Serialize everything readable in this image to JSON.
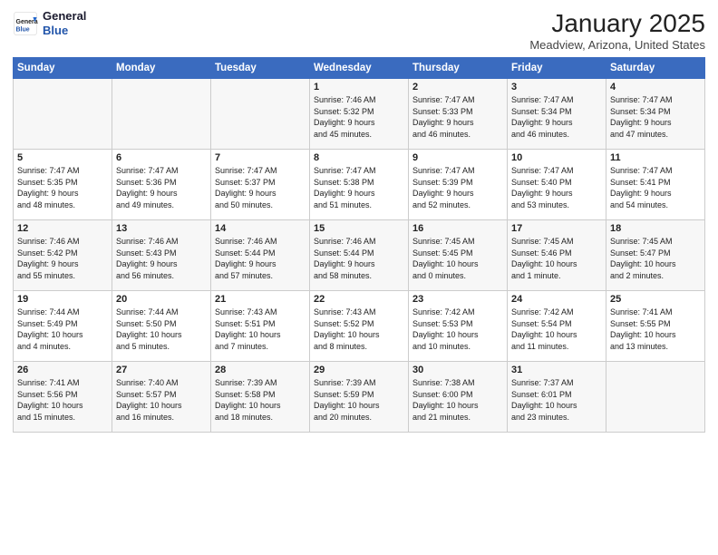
{
  "header": {
    "logo_general": "General",
    "logo_blue": "Blue",
    "title": "January 2025",
    "location": "Meadview, Arizona, United States"
  },
  "weekdays": [
    "Sunday",
    "Monday",
    "Tuesday",
    "Wednesday",
    "Thursday",
    "Friday",
    "Saturday"
  ],
  "weeks": [
    [
      {
        "day": "",
        "info": ""
      },
      {
        "day": "",
        "info": ""
      },
      {
        "day": "",
        "info": ""
      },
      {
        "day": "1",
        "info": "Sunrise: 7:46 AM\nSunset: 5:32 PM\nDaylight: 9 hours\nand 45 minutes."
      },
      {
        "day": "2",
        "info": "Sunrise: 7:47 AM\nSunset: 5:33 PM\nDaylight: 9 hours\nand 46 minutes."
      },
      {
        "day": "3",
        "info": "Sunrise: 7:47 AM\nSunset: 5:34 PM\nDaylight: 9 hours\nand 46 minutes."
      },
      {
        "day": "4",
        "info": "Sunrise: 7:47 AM\nSunset: 5:34 PM\nDaylight: 9 hours\nand 47 minutes."
      }
    ],
    [
      {
        "day": "5",
        "info": "Sunrise: 7:47 AM\nSunset: 5:35 PM\nDaylight: 9 hours\nand 48 minutes."
      },
      {
        "day": "6",
        "info": "Sunrise: 7:47 AM\nSunset: 5:36 PM\nDaylight: 9 hours\nand 49 minutes."
      },
      {
        "day": "7",
        "info": "Sunrise: 7:47 AM\nSunset: 5:37 PM\nDaylight: 9 hours\nand 50 minutes."
      },
      {
        "day": "8",
        "info": "Sunrise: 7:47 AM\nSunset: 5:38 PM\nDaylight: 9 hours\nand 51 minutes."
      },
      {
        "day": "9",
        "info": "Sunrise: 7:47 AM\nSunset: 5:39 PM\nDaylight: 9 hours\nand 52 minutes."
      },
      {
        "day": "10",
        "info": "Sunrise: 7:47 AM\nSunset: 5:40 PM\nDaylight: 9 hours\nand 53 minutes."
      },
      {
        "day": "11",
        "info": "Sunrise: 7:47 AM\nSunset: 5:41 PM\nDaylight: 9 hours\nand 54 minutes."
      }
    ],
    [
      {
        "day": "12",
        "info": "Sunrise: 7:46 AM\nSunset: 5:42 PM\nDaylight: 9 hours\nand 55 minutes."
      },
      {
        "day": "13",
        "info": "Sunrise: 7:46 AM\nSunset: 5:43 PM\nDaylight: 9 hours\nand 56 minutes."
      },
      {
        "day": "14",
        "info": "Sunrise: 7:46 AM\nSunset: 5:44 PM\nDaylight: 9 hours\nand 57 minutes."
      },
      {
        "day": "15",
        "info": "Sunrise: 7:46 AM\nSunset: 5:44 PM\nDaylight: 9 hours\nand 58 minutes."
      },
      {
        "day": "16",
        "info": "Sunrise: 7:45 AM\nSunset: 5:45 PM\nDaylight: 10 hours\nand 0 minutes."
      },
      {
        "day": "17",
        "info": "Sunrise: 7:45 AM\nSunset: 5:46 PM\nDaylight: 10 hours\nand 1 minute."
      },
      {
        "day": "18",
        "info": "Sunrise: 7:45 AM\nSunset: 5:47 PM\nDaylight: 10 hours\nand 2 minutes."
      }
    ],
    [
      {
        "day": "19",
        "info": "Sunrise: 7:44 AM\nSunset: 5:49 PM\nDaylight: 10 hours\nand 4 minutes."
      },
      {
        "day": "20",
        "info": "Sunrise: 7:44 AM\nSunset: 5:50 PM\nDaylight: 10 hours\nand 5 minutes."
      },
      {
        "day": "21",
        "info": "Sunrise: 7:43 AM\nSunset: 5:51 PM\nDaylight: 10 hours\nand 7 minutes."
      },
      {
        "day": "22",
        "info": "Sunrise: 7:43 AM\nSunset: 5:52 PM\nDaylight: 10 hours\nand 8 minutes."
      },
      {
        "day": "23",
        "info": "Sunrise: 7:42 AM\nSunset: 5:53 PM\nDaylight: 10 hours\nand 10 minutes."
      },
      {
        "day": "24",
        "info": "Sunrise: 7:42 AM\nSunset: 5:54 PM\nDaylight: 10 hours\nand 11 minutes."
      },
      {
        "day": "25",
        "info": "Sunrise: 7:41 AM\nSunset: 5:55 PM\nDaylight: 10 hours\nand 13 minutes."
      }
    ],
    [
      {
        "day": "26",
        "info": "Sunrise: 7:41 AM\nSunset: 5:56 PM\nDaylight: 10 hours\nand 15 minutes."
      },
      {
        "day": "27",
        "info": "Sunrise: 7:40 AM\nSunset: 5:57 PM\nDaylight: 10 hours\nand 16 minutes."
      },
      {
        "day": "28",
        "info": "Sunrise: 7:39 AM\nSunset: 5:58 PM\nDaylight: 10 hours\nand 18 minutes."
      },
      {
        "day": "29",
        "info": "Sunrise: 7:39 AM\nSunset: 5:59 PM\nDaylight: 10 hours\nand 20 minutes."
      },
      {
        "day": "30",
        "info": "Sunrise: 7:38 AM\nSunset: 6:00 PM\nDaylight: 10 hours\nand 21 minutes."
      },
      {
        "day": "31",
        "info": "Sunrise: 7:37 AM\nSunset: 6:01 PM\nDaylight: 10 hours\nand 23 minutes."
      },
      {
        "day": "",
        "info": ""
      }
    ]
  ]
}
